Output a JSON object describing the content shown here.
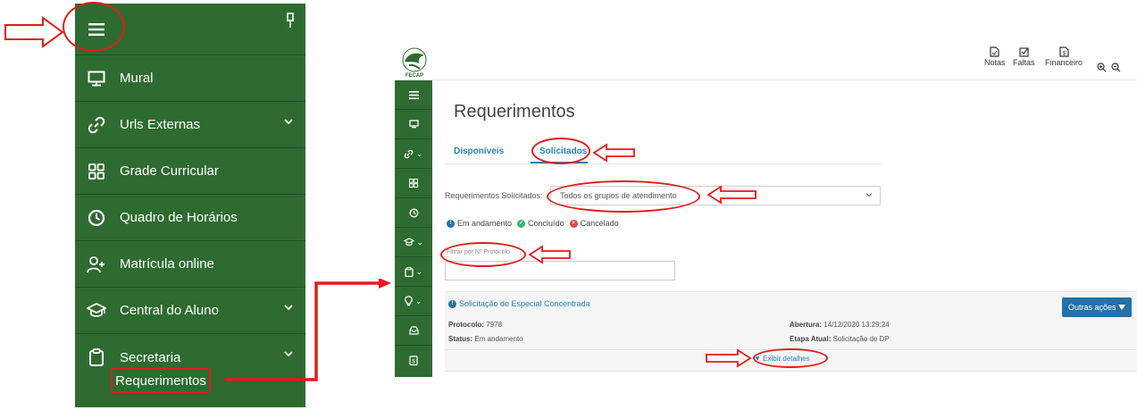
{
  "sidebar": {
    "items": [
      {
        "label": "Mural",
        "icon": "monitor-icon"
      },
      {
        "label": "Urls Externas",
        "icon": "link-icon"
      },
      {
        "label": "Grade Curricular",
        "icon": "grid-icon"
      },
      {
        "label": "Quadro de Horários",
        "icon": "clock-icon"
      },
      {
        "label": "Matrícula online",
        "icon": "user-add-icon"
      },
      {
        "label": "Central do Aluno",
        "icon": "graduation-cap-icon"
      },
      {
        "label": "Secretaria",
        "icon": "clipboard-icon"
      }
    ],
    "sub_item": "Requerimentos"
  },
  "app": {
    "logo_text": "FECAP",
    "toolbar": {
      "notas": "Notas",
      "faltas": "Faltas",
      "financeiro": "Financeiro"
    },
    "page_title": "Requerimentos",
    "tabs": [
      "Disponíveis",
      "Solicitados"
    ],
    "filter": {
      "label": "Requerimentos Solicitados:",
      "selected": "Todos os grupos de atendimento"
    },
    "legend": [
      "Em andamento",
      "Concluído",
      "Cancelado"
    ],
    "protocol_filter": {
      "label": "Filtrar por Nº Protocolo",
      "value": ""
    },
    "request": {
      "title": "Solicitação de Especial Concentrada",
      "protocolo_label": "Protocolo:",
      "protocolo_value": "7978",
      "status_label": "Status:",
      "status_value": "Em andamento",
      "abertura_label": "Abertura:",
      "abertura_value": "14/12/2020 13:29:24",
      "etapa_label": "Etapa Atual:",
      "etapa_value": "Solicitação de DP",
      "actions_button": "Outras ações",
      "details_link": "Exibir detalhes"
    }
  },
  "colors": {
    "sidebar_green": "#2e6b30",
    "annotation_red": "#e31b1b",
    "link_blue": "#2a7fb8"
  }
}
